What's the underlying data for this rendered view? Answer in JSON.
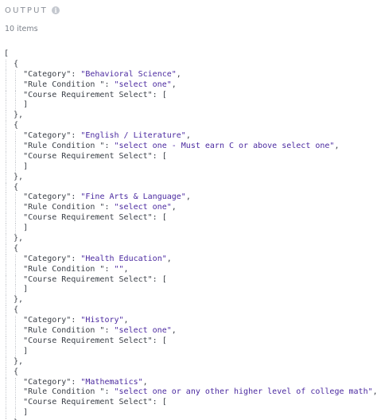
{
  "output": {
    "title": "OUTPUT",
    "info_icon": "info-icon",
    "count_text": "10 items"
  },
  "items": [
    {
      "category": "Behavioral Science",
      "rule_condition": "select one"
    },
    {
      "category": "English / Literature",
      "rule_condition": "select one - Must earn C or above select one"
    },
    {
      "category": "Fine Arts & Language",
      "rule_condition": "select one"
    },
    {
      "category": "Health Education",
      "rule_condition": ""
    },
    {
      "category": "History",
      "rule_condition": "select one"
    },
    {
      "category": "Mathematics",
      "rule_condition": "select one or any other higher level of college math"
    }
  ],
  "keys": {
    "category": "\"Category\"",
    "rule_condition": "\"Rule Condition \"",
    "course_requirement": "\"Course Requirement Select\""
  },
  "colors": {
    "key": "#3a3f47",
    "string": "#4b2aa0",
    "muted": "#8a8f98"
  }
}
